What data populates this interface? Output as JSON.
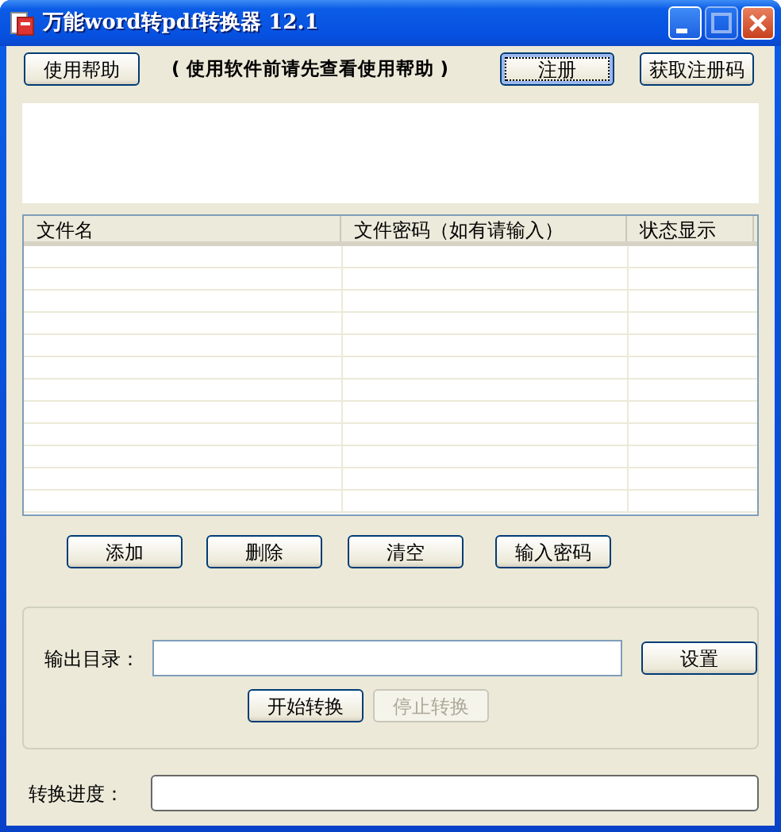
{
  "window": {
    "title": "万能word转pdf转换器 12.1",
    "controls": [
      {
        "kind": "minimize",
        "disabled": false
      },
      {
        "kind": "maximize",
        "disabled": true
      },
      {
        "kind": "close",
        "disabled": false
      }
    ]
  },
  "top_bar": {
    "help_button": "使用帮助",
    "hint": "( 使用软件前请先查看使用帮助 )",
    "buttons": [
      {
        "label": "注册",
        "focused": true
      },
      {
        "label": "获取注册码",
        "focused": false
      }
    ]
  },
  "file_list": {
    "columns": [
      "文件名",
      "文件密码（如有请输入）",
      "状态显示"
    ]
  },
  "list_buttons": [
    "添加",
    "删除",
    "清空",
    "输入密码"
  ],
  "output": {
    "label": "输出目录：",
    "set_button": "设置",
    "buttons": [
      {
        "label": "开始转换",
        "disabled": false
      },
      {
        "label": "停止转换",
        "disabled": true
      }
    ]
  },
  "progress": {
    "label": "转换进度：",
    "level": 0
  }
}
